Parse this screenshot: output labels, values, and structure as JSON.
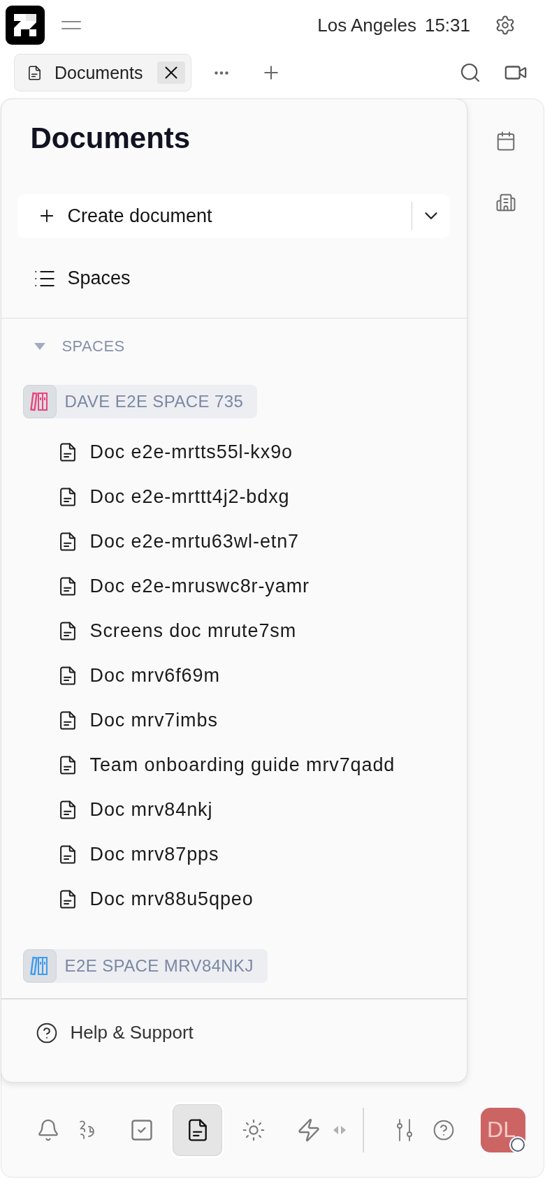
{
  "header": {
    "location": "Los Angeles",
    "time": "15:31"
  },
  "tabs": [
    {
      "label": "Documents",
      "selected": true
    }
  ],
  "panel": {
    "title": "Documents",
    "create_label": "Create document",
    "nav_items": [
      {
        "label": "Spaces"
      }
    ],
    "section": {
      "label": "SPACES",
      "expanded": true
    },
    "spaces": [
      {
        "name": "DAVE E2E SPACE 735",
        "color": "#e8457a",
        "documents": [
          {
            "title": "Doc e2e-mrtts55l-kx9o"
          },
          {
            "title": "Doc e2e-mrttt4j2-bdxg"
          },
          {
            "title": "Doc e2e-mrtu63wl-etn7"
          },
          {
            "title": "Doc e2e-mruswc8r-yamr"
          },
          {
            "title": "Screens doc mrute7sm"
          },
          {
            "title": "Doc mrv6f69m"
          },
          {
            "title": "Doc mrv7imbs"
          },
          {
            "title": "Team onboarding guide mrv7qadd"
          },
          {
            "title": "Doc mrv84nkj"
          },
          {
            "title": "Doc mrv87pps"
          },
          {
            "title": "Doc mrv88u5qpeo"
          }
        ]
      },
      {
        "name": "E2E SPACE MRV84NKJ",
        "color": "#3d9bef"
      }
    ],
    "help_label": "Help & Support"
  },
  "bottom_nav": [
    {
      "selected": false
    },
    {
      "selected": false
    },
    {
      "selected": false
    },
    {
      "selected": true
    },
    {
      "selected": false
    },
    {
      "selected": false
    }
  ],
  "avatar": {
    "initials": "DL"
  }
}
